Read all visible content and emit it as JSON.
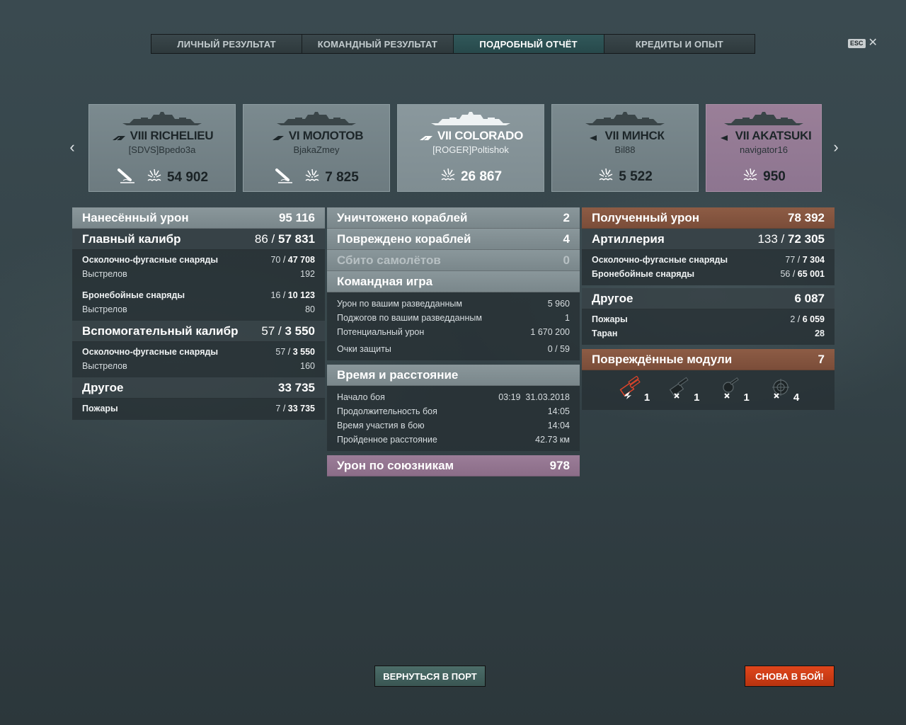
{
  "tabs": [
    {
      "label": "ЛИЧНЫЙ РЕЗУЛЬТАТ",
      "active": false
    },
    {
      "label": "КОМАНДНЫЙ РЕЗУЛЬТАТ",
      "active": false
    },
    {
      "label": "ПОДРОБНЫЙ ОТЧЁТ",
      "active": true
    },
    {
      "label": "КРЕДИТЫ И ОПЫТ",
      "active": false
    }
  ],
  "esc": {
    "badge": "ESC",
    "close": "✕"
  },
  "carousel": {
    "prev_icon": "chevron-left-icon",
    "next_icon": "chevron-right-icon",
    "ships": [
      {
        "name": "VIII RICHELIEU",
        "player": "[SDVS]Bpedo3a",
        "damage": "54 902",
        "class_icon": "battleship-icon",
        "extra_icon": "torpedo-icon",
        "highlight": false
      },
      {
        "name": "VI МОЛОТОВ",
        "player": "BjakaZmey",
        "damage": "7 825",
        "class_icon": "cruiser-icon",
        "extra_icon": "torpedo-icon",
        "highlight": false
      },
      {
        "name": "VII COLORADO",
        "player": "[ROGER]Poltishok",
        "damage": "26 867",
        "class_icon": "battleship-icon",
        "highlight": false,
        "light": true
      },
      {
        "name": "VII МИНСК",
        "player": "Bil88",
        "damage": "5 522",
        "class_icon": "destroyer-icon",
        "highlight": false
      },
      {
        "name": "VII AKATSUKI",
        "player": "navigator16",
        "damage": "950",
        "class_icon": "destroyer-icon",
        "highlight": true
      }
    ]
  },
  "left": {
    "dealt": {
      "label": "Нанесённый урон",
      "value": "95 116"
    },
    "main": {
      "label": "Главный калибр",
      "hits": "86",
      "value": "57 831"
    },
    "main_he": {
      "label": "Осколочно-фугасные снаряды",
      "hits": "70",
      "value": "47 708"
    },
    "main_he_shots": {
      "label": "Выстрелов",
      "value": "192"
    },
    "main_ap": {
      "label": "Бронебойные снаряды",
      "hits": "16",
      "value": "10 123"
    },
    "main_ap_shots": {
      "label": "Выстрелов",
      "value": "80"
    },
    "secondary": {
      "label": "Вспомогательный калибр",
      "hits": "57",
      "value": "3 550"
    },
    "sec_he": {
      "label": "Осколочно-фугасные снаряды",
      "hits": "57",
      "value": "3 550"
    },
    "sec_he_shots": {
      "label": "Выстрелов",
      "value": "160"
    },
    "other": {
      "label": "Другое",
      "value": "33 735"
    },
    "fires": {
      "label": "Пожары",
      "hits": "7",
      "value": "33 735"
    }
  },
  "middle": {
    "destroyed": {
      "label": "Уничтожено кораблей",
      "value": "2"
    },
    "damaged": {
      "label": "Повреждено кораблей",
      "value": "4"
    },
    "planes": {
      "label": "Сбито самолётов",
      "value": "0"
    },
    "team": {
      "label": "Командная игра"
    },
    "spotting_dmg": {
      "label": "Урон по вашим разведданным",
      "value": "5 960"
    },
    "spotting_fires": {
      "label": "Поджогов по вашим разведданным",
      "value": "1"
    },
    "potential": {
      "label": "Потенциальный урон",
      "value": "1 670 200"
    },
    "defense": {
      "label": "Очки защиты",
      "value": "0 / 59"
    },
    "time": {
      "label": "Время и расстояние"
    },
    "start": {
      "label": "Начало боя",
      "value": "03:19  31.03.2018"
    },
    "duration": {
      "label": "Продолжительность боя",
      "value": "14:05"
    },
    "participation": {
      "label": "Время участия в бою",
      "value": "14:04"
    },
    "distance": {
      "label": "Пройденное расстояние",
      "value": "42.73 км"
    },
    "allies": {
      "label": "Урон по союзникам",
      "value": "978"
    }
  },
  "right": {
    "received": {
      "label": "Полученный урон",
      "value": "78 392"
    },
    "artillery": {
      "label": "Артиллерия",
      "hits": "133",
      "value": "72 305"
    },
    "art_he": {
      "label": "Осколочно-фугасные снаряды",
      "hits": "77",
      "value": "7 304"
    },
    "art_ap": {
      "label": "Бронебойные снаряды",
      "hits": "56",
      "value": "65 001"
    },
    "other": {
      "label": "Другое",
      "value": "6 087"
    },
    "fires": {
      "label": "Пожары",
      "hits": "2",
      "value": "6 059"
    },
    "ram": {
      "label": "Таран",
      "value": "28"
    },
    "modules": {
      "label": "Повреждённые модули",
      "value": "7"
    },
    "module_list": [
      {
        "icon": "main-battery-icon",
        "count": "1",
        "state": "incapacitated"
      },
      {
        "icon": "secondary-battery-icon",
        "count": "1",
        "state": "destroyed"
      },
      {
        "icon": "aa-gun-icon",
        "count": "1",
        "state": "destroyed"
      },
      {
        "icon": "fire-control-icon",
        "count": "4",
        "state": "destroyed"
      }
    ]
  },
  "buttons": {
    "port": "ВЕРНУТЬСЯ В ПОРТ",
    "battle": "СНОВА В БОЙ!"
  },
  "colors": {
    "accent_tab": "#27494b",
    "received": "#8d5c45",
    "allies": "#9b7d98",
    "battle_button": "#d23f17",
    "module_alert": "#e0452a"
  }
}
